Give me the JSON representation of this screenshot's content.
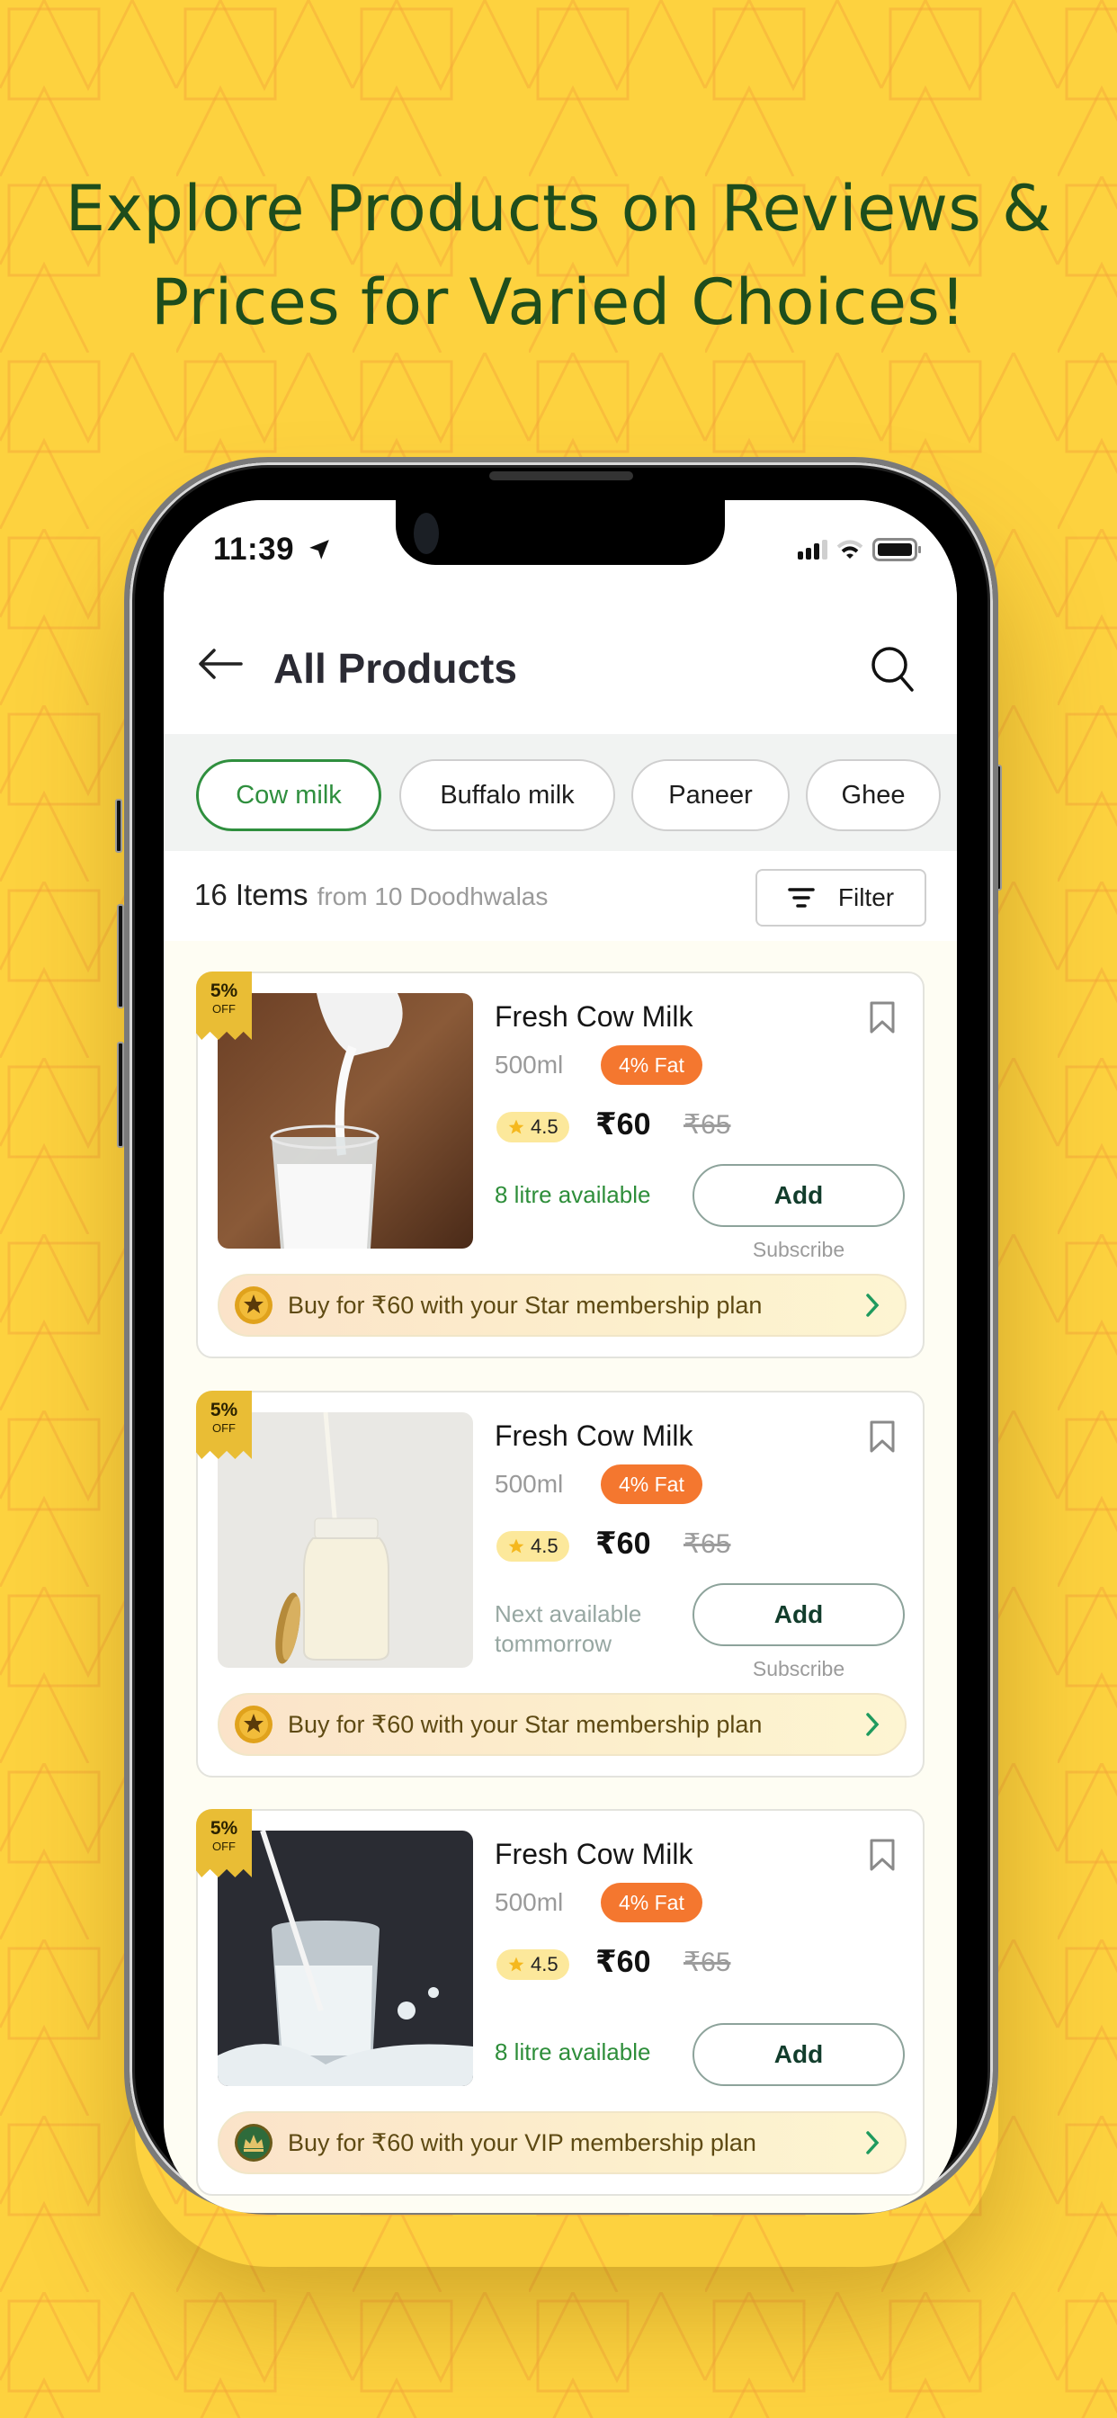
{
  "headline": [
    "Explore Products  on Reviews &",
    "Prices for Varied Choices!"
  ],
  "colors": {
    "background": "#FDD23F",
    "headline": "#1E4D1C",
    "accent_green": "#2F8F3E",
    "fat_badge": "#F4772F",
    "ribbon": "#E9BD35",
    "rating_pill": "#FCE89B"
  },
  "status_bar": {
    "time": "11:39",
    "icons": [
      "location-arrow-icon",
      "signal-icon",
      "wifi-icon",
      "battery-icon"
    ]
  },
  "app_bar": {
    "title": "All Products",
    "back_icon": "arrow-left-icon",
    "search_icon": "search-icon"
  },
  "categories": [
    {
      "label": "Cow milk",
      "active": true
    },
    {
      "label": "Buffalo milk",
      "active": false
    },
    {
      "label": "Paneer",
      "active": false
    },
    {
      "label": "Ghee",
      "active": false
    }
  ],
  "summary": {
    "count": "16 Items",
    "source": "from 10 Doodhwalas",
    "filter_label": "Filter"
  },
  "products": [
    {
      "discount_pct": "5%",
      "discount_off": "OFF",
      "name": "Fresh Cow Milk",
      "quantity": "500ml",
      "fat": "4% Fat",
      "rating": "4.5",
      "price": "₹60",
      "mrp": "₹65",
      "availability": "8 litre available",
      "add_label": "Add",
      "subscribe_label": "Subscribe",
      "membership_text": "Buy for  ₹60 with your Star membership plan",
      "membership_icon": "star-coin-icon",
      "image": "milk-pouring-into-glass"
    },
    {
      "discount_pct": "5%",
      "discount_off": "OFF",
      "name": "Fresh Cow Milk",
      "quantity": "500ml",
      "fat": "4% Fat",
      "rating": "4.5",
      "price": "₹60",
      "mrp": "₹65",
      "availability": "Next available tommorrow",
      "add_label": "Add",
      "subscribe_label": "Subscribe",
      "membership_text": "Buy for  ₹60 with your Star membership plan",
      "membership_icon": "star-coin-icon",
      "image": "milk-bottle-with-lid"
    },
    {
      "discount_pct": "5%",
      "discount_off": "OFF",
      "name": "Fresh Cow Milk",
      "quantity": "500ml",
      "fat": "4% Fat",
      "rating": "4.5",
      "price": "₹60",
      "mrp": "₹65",
      "availability": "8 litre available",
      "add_label": "Add",
      "membership_text": "Buy for  ₹60 with your VIP membership plan",
      "membership_icon": "crown-badge-icon",
      "image": "milk-splash-glass"
    }
  ]
}
